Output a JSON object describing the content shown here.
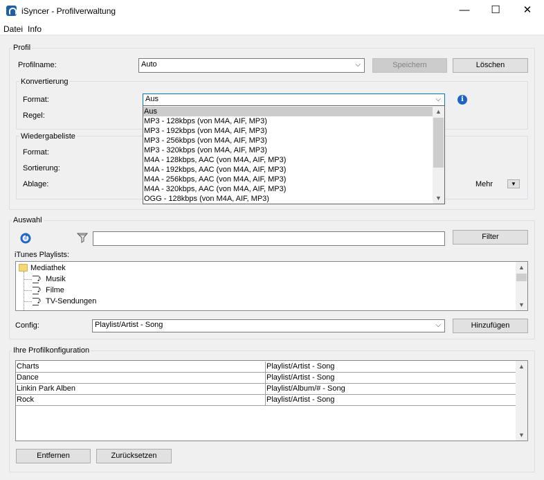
{
  "window": {
    "title": "iSyncer - Profilverwaltung",
    "minimize": "—",
    "maximize": "☐",
    "close": "✕"
  },
  "menu": {
    "items": [
      "Datei",
      "Info"
    ]
  },
  "profil": {
    "group_label": "Profil",
    "name_label": "Profilname:",
    "name_value": "Auto",
    "save_label": "Speichern",
    "delete_label": "Löschen"
  },
  "konvertierung": {
    "group_label": "Konvertierung",
    "format_label": "Format:",
    "format_value": "Aus",
    "rule_label": "Regel:",
    "format_options": [
      "Aus",
      "MP3 - 128kbps (von M4A, AIF, MP3)",
      "MP3 - 192kbps (von M4A, AIF, MP3)",
      "MP3 - 256kbps (von M4A, AIF, MP3)",
      "MP3 - 320kbps (von M4A, AIF, MP3)",
      "M4A - 128kbps, AAC (von M4A, AIF, MP3)",
      "M4A - 192kbps, AAC (von M4A, AIF, MP3)",
      "M4A - 256kbps, AAC (von M4A, AIF, MP3)",
      "M4A - 320kbps, AAC (von M4A, AIF, MP3)",
      "OGG - 128kbps (von M4A, AIF, MP3)"
    ],
    "selected_index": 0
  },
  "wiedergabeliste": {
    "group_label": "Wiedergabeliste",
    "format_label": "Format:",
    "sort_label": "Sortierung:",
    "storage_label": "Ablage:",
    "more_label": "Mehr"
  },
  "auswahl": {
    "group_label": "Auswahl",
    "filter_value": "",
    "filter_button": "Filter",
    "playlists_label": "iTunes Playlists:",
    "tree": [
      {
        "label": "Mediathek",
        "type": "folder",
        "level": 0
      },
      {
        "label": "Musik",
        "type": "playlist",
        "level": 1
      },
      {
        "label": "Filme",
        "type": "playlist",
        "level": 1
      },
      {
        "label": "TV-Sendungen",
        "type": "playlist",
        "level": 1
      }
    ],
    "config_label": "Config:",
    "config_value": "Playlist/Artist - Song",
    "add_button": "Hinzufügen"
  },
  "profilkonfiguration": {
    "group_label": "Ihre Profilkonfiguration",
    "rows": [
      {
        "playlist": "Charts",
        "config": "Playlist/Artist - Song"
      },
      {
        "playlist": "Dance",
        "config": "Playlist/Artist - Song"
      },
      {
        "playlist": "Linkin Park Alben",
        "config": "Playlist/Album/# - Song"
      },
      {
        "playlist": "Rock",
        "config": "Playlist/Artist - Song"
      }
    ],
    "remove_button": "Entfernen",
    "reset_button": "Zurücksetzen"
  },
  "icons": {
    "app": "isyncer-app-icon",
    "info": "info-icon",
    "refresh": "refresh-icon",
    "filter": "filter-icon",
    "dropdown": "chevron-down-icon"
  },
  "colors": {
    "accent": "#0078d7",
    "info": "#1d63c8",
    "selected_row": "#cccccc"
  }
}
